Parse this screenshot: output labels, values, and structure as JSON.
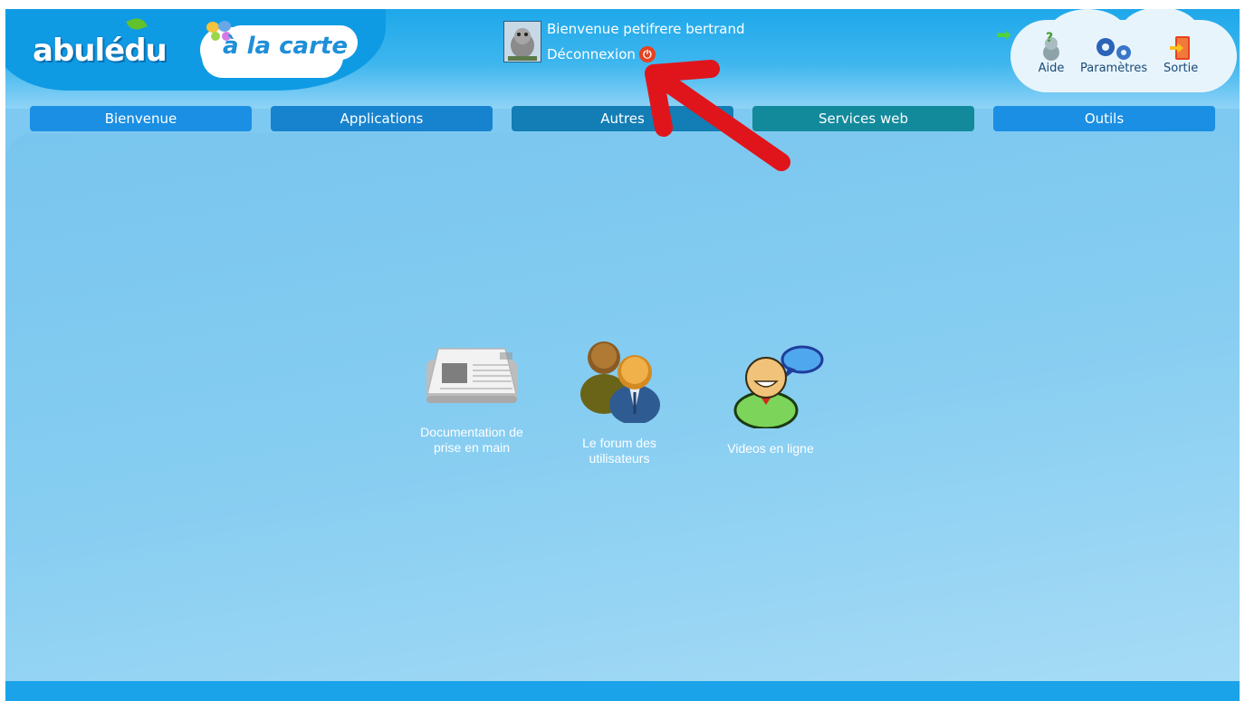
{
  "header": {
    "logo_text": "abulédu",
    "logo_sub": "à la carte",
    "welcome": "Bienvenue petifrere bertrand",
    "logout_label": "Déconnexion",
    "tools": [
      {
        "label": "Aide",
        "icon": "help-icon"
      },
      {
        "label": "Paramètres",
        "icon": "gears-icon"
      },
      {
        "label": "Sortie",
        "icon": "exit-icon"
      }
    ]
  },
  "nav": {
    "tabs": [
      {
        "label": "Bienvenue",
        "color": "#1a8fe3"
      },
      {
        "label": "Applications",
        "color": "#1783cf"
      },
      {
        "label": "Autres",
        "color": "#137db5"
      },
      {
        "label": "Services web",
        "color": "#128a9c"
      },
      {
        "label": "Outils",
        "color": "#1a8fe3"
      }
    ]
  },
  "apps": [
    {
      "label_line1": "Documentation de",
      "label_line2": "prise en main",
      "icon": "newspaper-icon"
    },
    {
      "label_line1": "Le forum des",
      "label_line2": "utilisateurs",
      "icon": "users-icon"
    },
    {
      "label_line1": "Videos en ligne",
      "label_line2": "",
      "icon": "chat-user-icon"
    }
  ],
  "colors": {
    "annotation_arrow": "#e0151b",
    "header": "#1ea8ea",
    "content": "#82caf0"
  }
}
